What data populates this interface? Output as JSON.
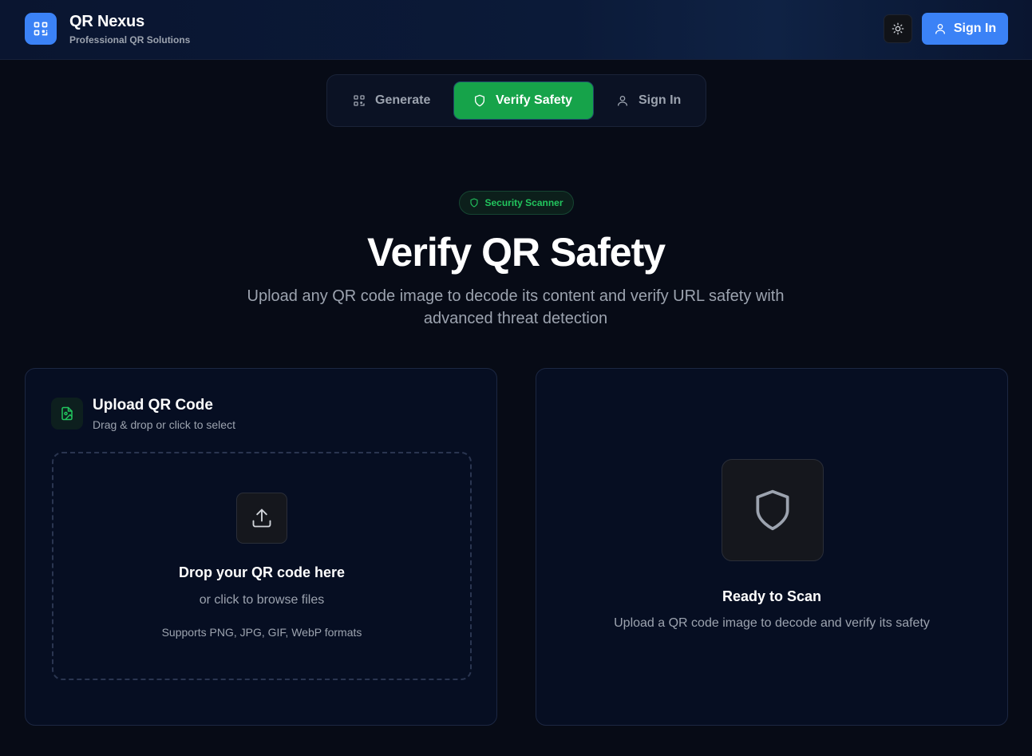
{
  "header": {
    "app_name": "QR Nexus",
    "tagline": "Professional QR Solutions",
    "logo_icon": "qr-code-icon",
    "theme_toggle_icon": "sun-icon",
    "sign_in_label": "Sign In",
    "sign_in_icon": "user-icon"
  },
  "tabs": [
    {
      "label": "Generate",
      "icon": "qr-code-icon",
      "active": false
    },
    {
      "label": "Verify Safety",
      "icon": "shield-icon",
      "active": true
    },
    {
      "label": "Sign In",
      "icon": "user-icon",
      "active": false
    }
  ],
  "hero": {
    "badge": "Security Scanner",
    "title": "Verify QR Safety",
    "description": "Upload any QR code image to decode its content and verify URL safety with advanced threat detection"
  },
  "upload_card": {
    "title": "Upload QR Code",
    "subtitle": "Drag & drop or click to select",
    "dropzone": {
      "title": "Drop your QR code here",
      "subtitle": "or click to browse files",
      "formats": "Supports PNG, JPG, GIF, WebP formats"
    }
  },
  "result_card": {
    "title": "Ready to Scan",
    "subtitle": "Upload a QR code image to decode and verify its safety"
  },
  "colors": {
    "background": "#070b16",
    "primary_blue": "#3b82f6",
    "active_green": "#16a34a",
    "accent_green": "#22c55e",
    "muted_text": "#9ca3af"
  }
}
